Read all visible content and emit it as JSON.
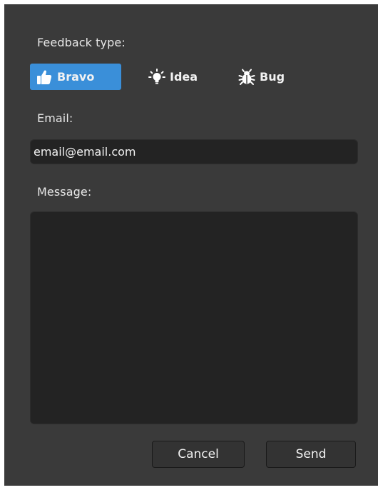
{
  "feedback_type": {
    "label": "Feedback type:",
    "options": [
      {
        "label": "Bravo",
        "icon": "thumbs-up-icon",
        "selected": true
      },
      {
        "label": "Idea",
        "icon": "lightbulb-icon",
        "selected": false
      },
      {
        "label": "Bug",
        "icon": "bug-icon",
        "selected": false
      }
    ]
  },
  "email": {
    "label": "Email:",
    "value": "email@email.com"
  },
  "message": {
    "label": "Message:",
    "value": ""
  },
  "actions": {
    "cancel_label": "Cancel",
    "send_label": "Send"
  },
  "colors": {
    "dialog_background": "#3a3a3a",
    "field_background": "#232323",
    "selected_accent": "#3a8fd9",
    "text": "#e8e8e8"
  }
}
